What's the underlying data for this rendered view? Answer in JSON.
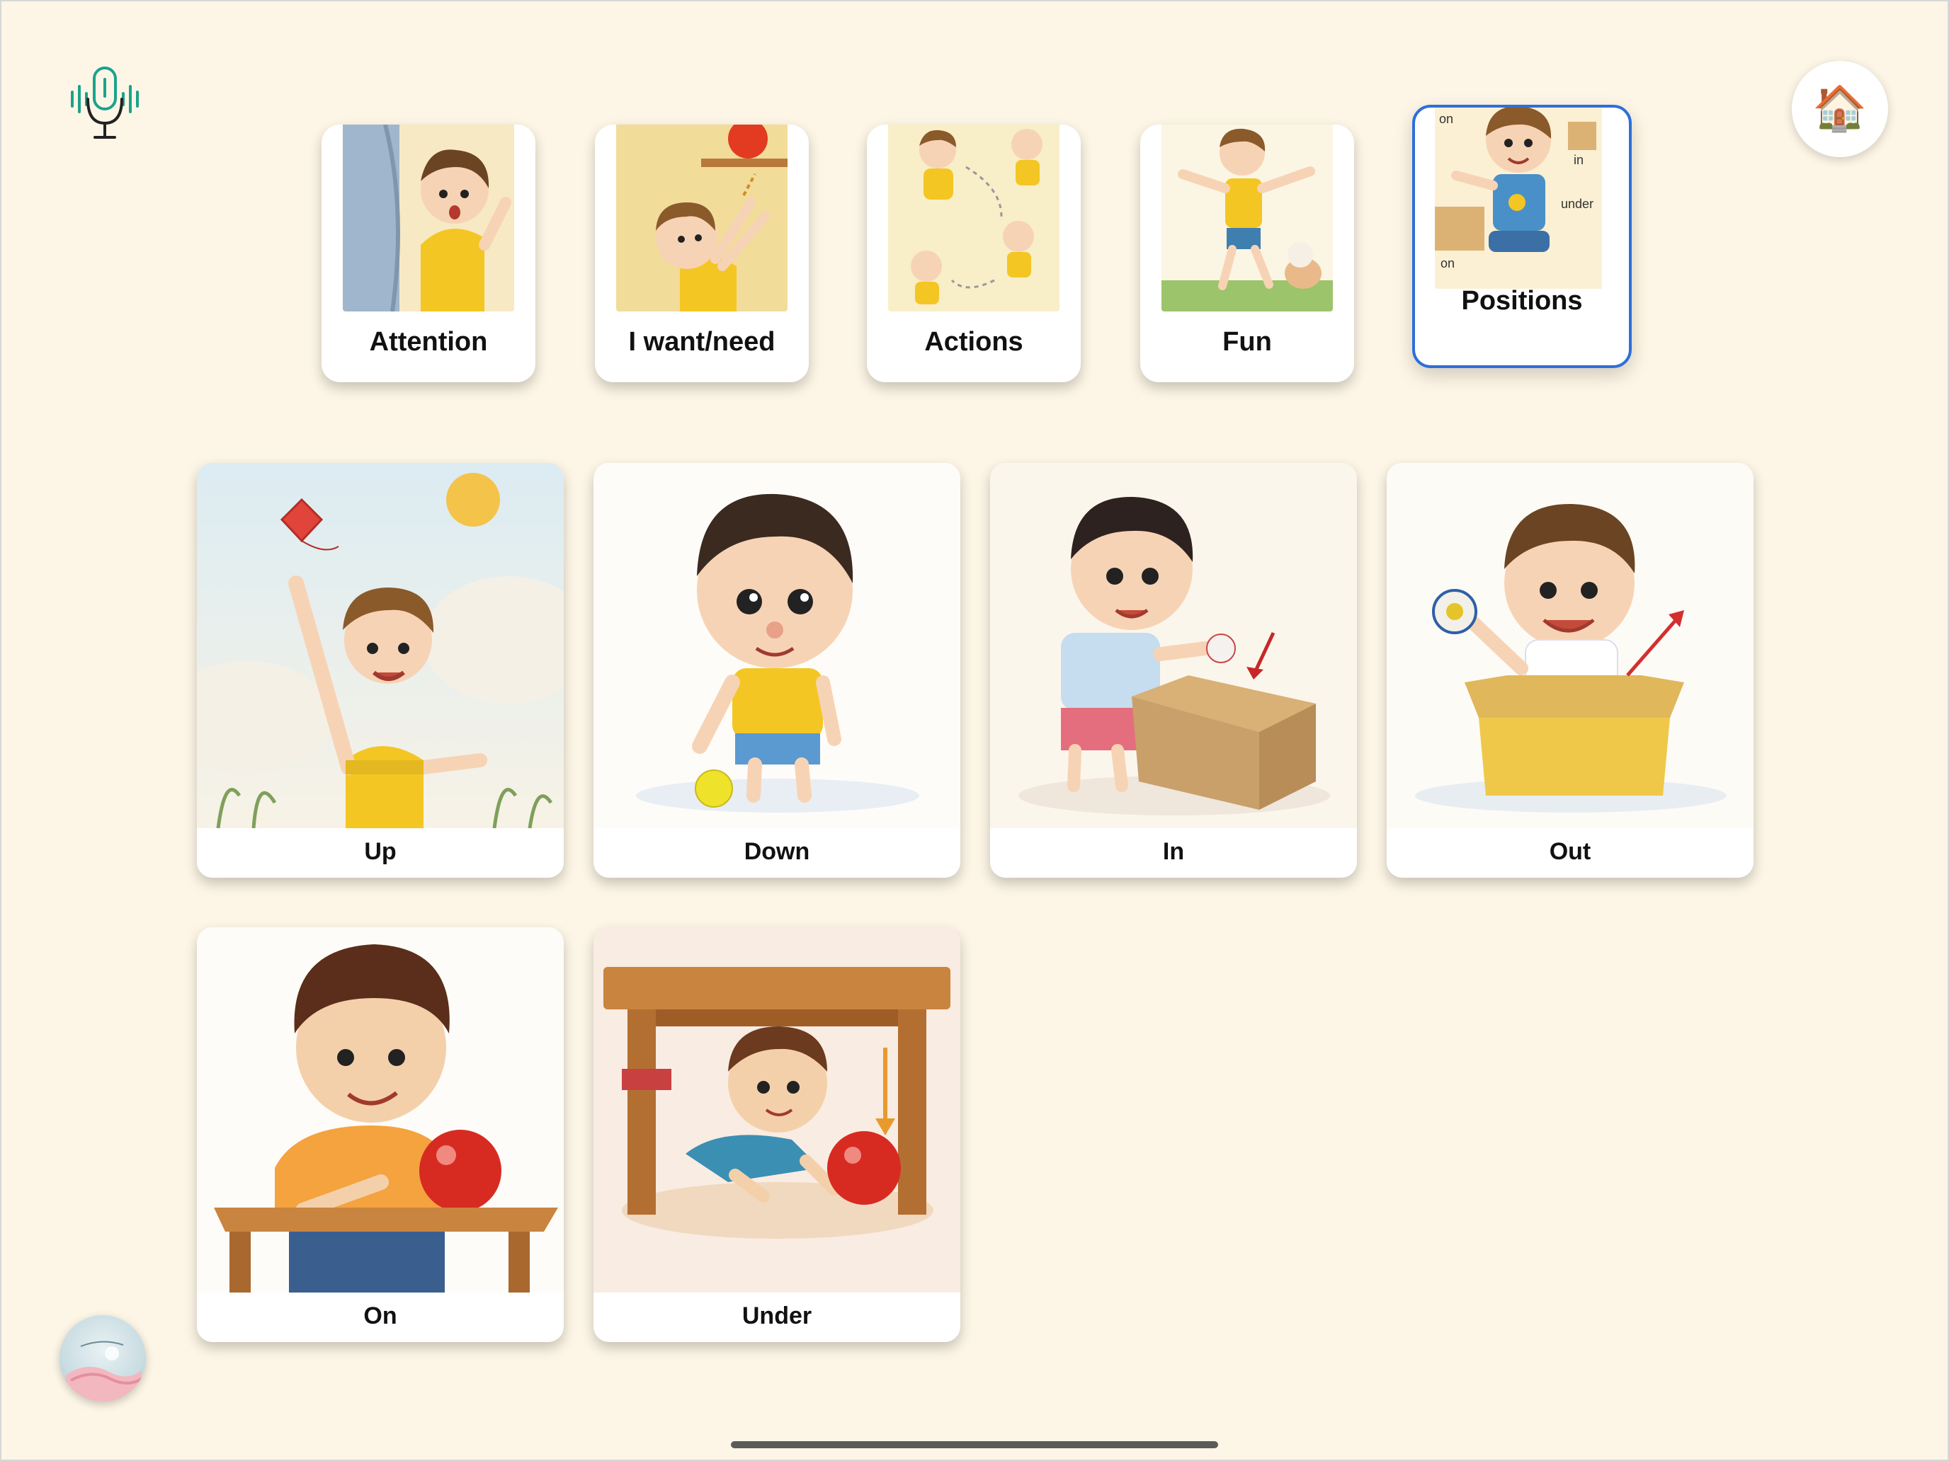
{
  "toolbar": {
    "mic_icon": "microphone-icon",
    "home_icon": "🏠"
  },
  "categories": [
    {
      "label": "Attention",
      "selected": false
    },
    {
      "label": "I want/need",
      "selected": false
    },
    {
      "label": "Actions",
      "selected": false
    },
    {
      "label": "Fun",
      "selected": false
    },
    {
      "label": "Positions",
      "selected": true,
      "image_text": [
        "on",
        "in",
        "under",
        "on"
      ]
    }
  ],
  "words": [
    {
      "label": "Up"
    },
    {
      "label": "Down"
    },
    {
      "label": "In"
    },
    {
      "label": "Out"
    },
    {
      "label": "On"
    },
    {
      "label": "Under"
    }
  ],
  "colors": {
    "background": "#fdf6e6",
    "selected_border": "#2e6fd9",
    "mic_teal": "#1aa38b"
  }
}
